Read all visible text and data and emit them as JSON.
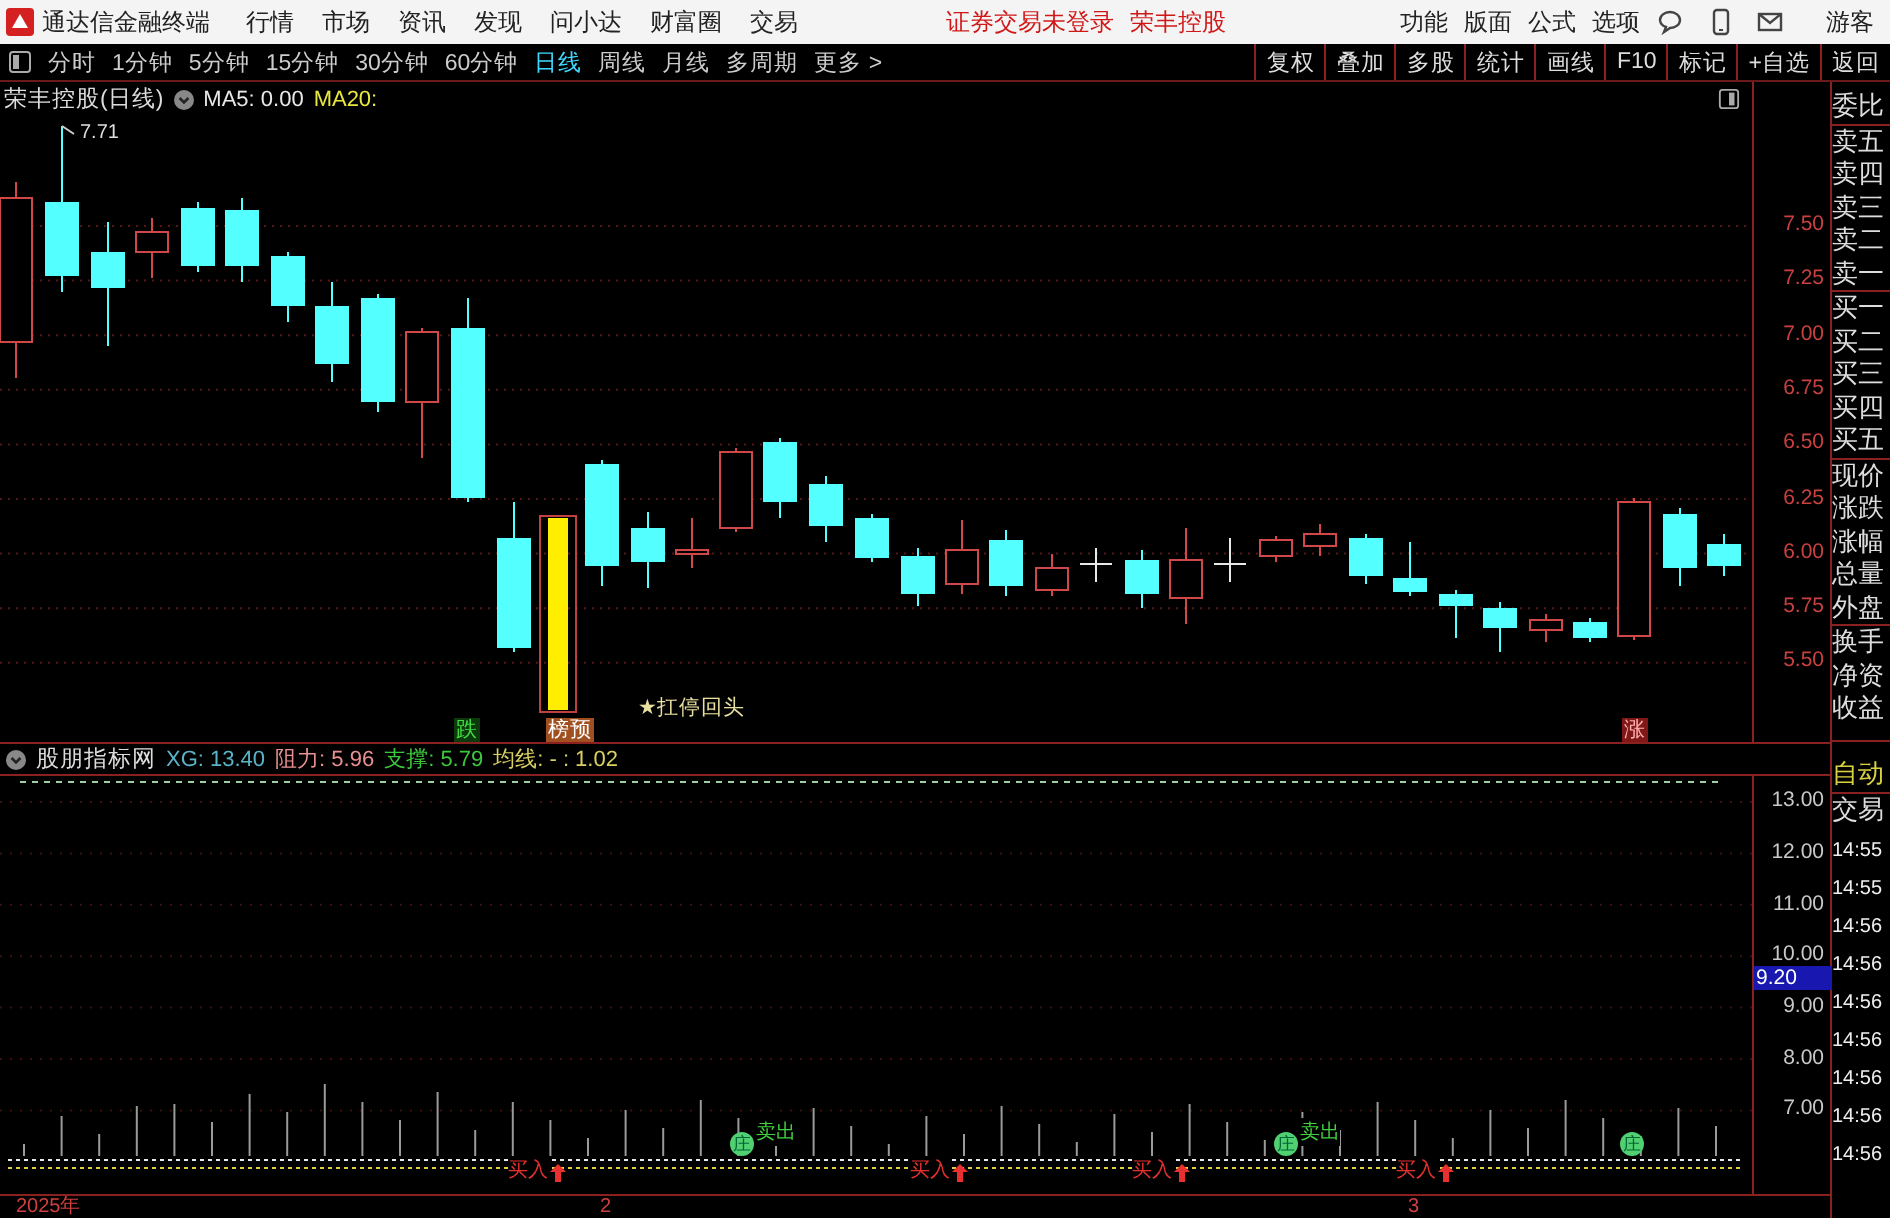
{
  "title_bar": {
    "app_name": "通达信金融终端",
    "menu": [
      "行情",
      "市场",
      "资讯",
      "发现",
      "问小达",
      "财富圈",
      "交易"
    ],
    "status": [
      "证券交易未登录",
      "荣丰控股"
    ],
    "right_menu": [
      "功能",
      "版面",
      "公式",
      "选项"
    ],
    "user": "游客"
  },
  "toolbar": {
    "periods": [
      {
        "label": "分时",
        "selected": false
      },
      {
        "label": "1分钟",
        "selected": false
      },
      {
        "label": "5分钟",
        "selected": false
      },
      {
        "label": "15分钟",
        "selected": false
      },
      {
        "label": "30分钟",
        "selected": false
      },
      {
        "label": "60分钟",
        "selected": false
      },
      {
        "label": "日线",
        "selected": true
      },
      {
        "label": "周线",
        "selected": false
      },
      {
        "label": "月线",
        "selected": false
      },
      {
        "label": "多周期",
        "selected": false
      },
      {
        "label": "更多 >",
        "selected": false
      }
    ],
    "buttons": [
      "复权",
      "叠加",
      "多股",
      "统计",
      "画线",
      "F10",
      "标记",
      "+自选",
      "返回"
    ]
  },
  "main_chart": {
    "title": "荣丰控股(日线)",
    "indicators": [
      {
        "text": "MA5: 0.00",
        "color": "#e8e8e8"
      },
      {
        "text": "MA20:",
        "color": "#e8e840"
      }
    ],
    "peak_label": "7.71",
    "markers": [
      {
        "kind": "fall",
        "text": "跌"
      },
      {
        "kind": "board",
        "text": "榜预"
      },
      {
        "kind": "note",
        "text": "★扛停回头"
      },
      {
        "kind": "rise",
        "text": "涨"
      }
    ],
    "price_axis": [
      "7.50",
      "7.25",
      "7.00",
      "6.75",
      "6.50",
      "6.25",
      "6.00",
      "5.75",
      "5.50"
    ]
  },
  "indicator_panel": {
    "name": "股朋指标网",
    "values": [
      {
        "text": "XG: 13.40",
        "color": "#5ab4c8"
      },
      {
        "text": "阻力: 5.96",
        "color": "#e89090"
      },
      {
        "text": "支撑: 5.79",
        "color": "#3cc83c"
      },
      {
        "text": "均线: - : 1.02",
        "color": "#d8d060"
      }
    ],
    "axis": [
      "13.00",
      "12.00",
      "11.00",
      "10.00",
      "9.00",
      "8.00",
      "7.00"
    ],
    "highlight_value": "9.20",
    "signals": [
      {
        "kind": "buy",
        "text": "买入"
      },
      {
        "kind": "sell",
        "text": "卖出",
        "badge": "庄"
      },
      {
        "kind": "buy",
        "text": "买入"
      },
      {
        "kind": "buy",
        "text": "买入"
      },
      {
        "kind": "sell",
        "text": "卖出",
        "badge": "庄"
      },
      {
        "kind": "buy",
        "text": "买入"
      },
      {
        "kind": "badge",
        "badge": "庄"
      }
    ]
  },
  "time_axis": [
    "2025年",
    "2",
    "3"
  ],
  "right_panel": {
    "groups": [
      {
        "items": [
          "委比"
        ]
      },
      {
        "items": [
          "卖五",
          "卖四",
          "卖三",
          "卖二",
          "卖一"
        ]
      },
      {
        "items": [
          "买一",
          "买二",
          "买三",
          "买四",
          "买五"
        ]
      },
      {
        "items": [
          "现价",
          "涨跌",
          "涨幅",
          "总量",
          "外盘"
        ]
      },
      {
        "items": [
          "换手",
          "净资",
          "收益"
        ]
      }
    ],
    "mode": "自动",
    "trade_header": "交易",
    "times": [
      "14:55",
      "14:55",
      "14:56",
      "14:56",
      "14:56",
      "14:56",
      "14:56",
      "14:56",
      "14:56"
    ]
  }
}
